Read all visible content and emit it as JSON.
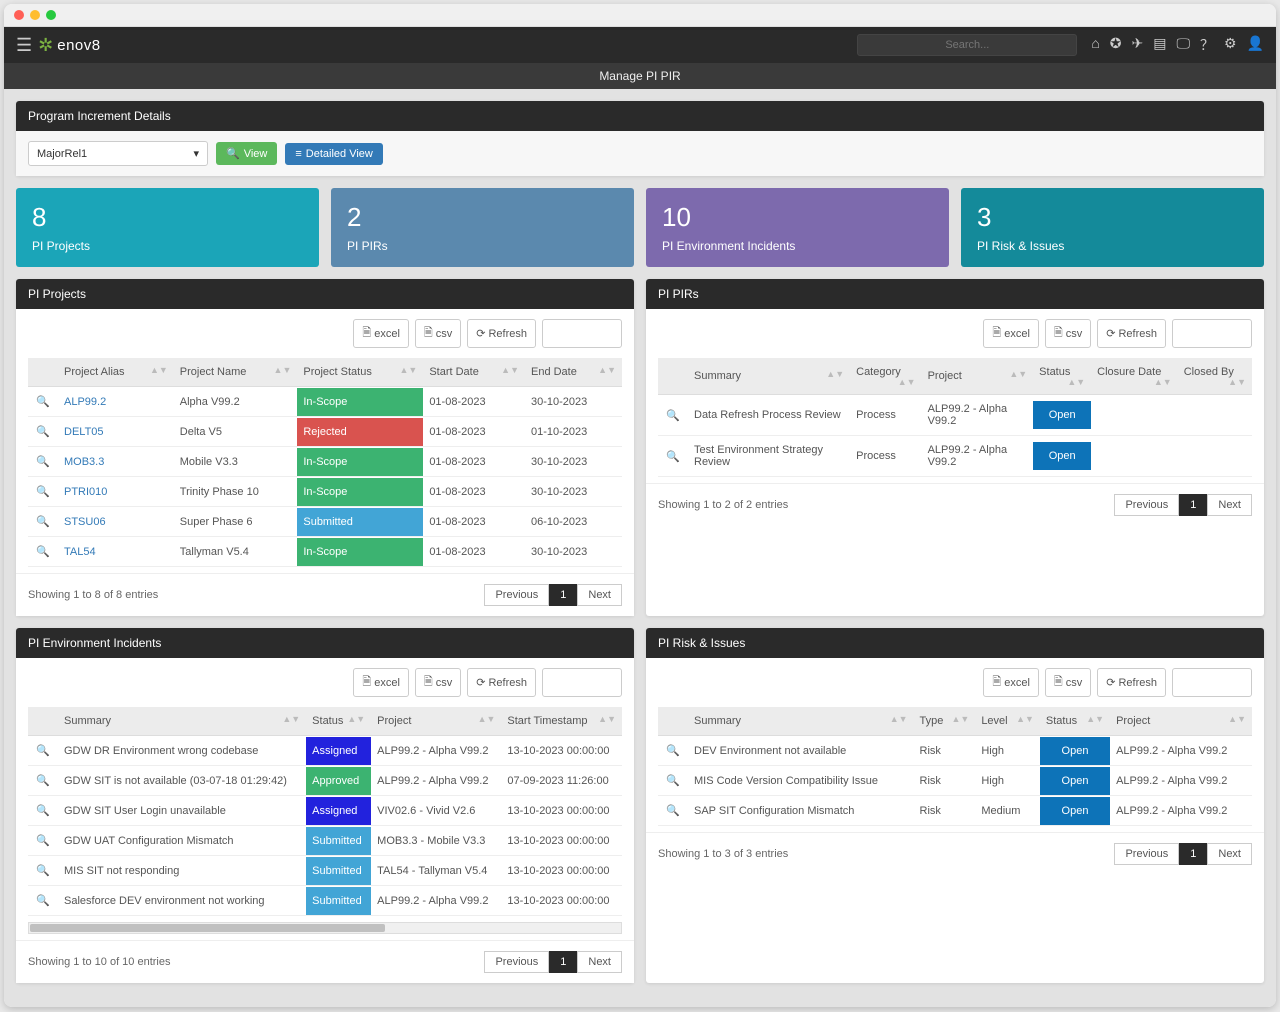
{
  "header": {
    "brand": "enov8",
    "search_placeholder": "Search...",
    "page_title": "Manage PI PIR"
  },
  "details": {
    "panel_title": "Program Increment Details",
    "release_selected": "MajorRel1",
    "view_btn": "View",
    "detailed_btn": "Detailed View"
  },
  "stats": [
    {
      "value": "8",
      "label": "PI Projects"
    },
    {
      "value": "2",
      "label": "PI PIRs"
    },
    {
      "value": "10",
      "label": "PI Environment Incidents"
    },
    {
      "value": "3",
      "label": "PI Risk & Issues"
    }
  ],
  "buttons": {
    "excel": "excel",
    "csv": "csv",
    "refresh": "Refresh",
    "previous": "Previous",
    "next": "Next",
    "page1": "1"
  },
  "projects": {
    "title": "PI Projects",
    "cols": [
      "Project Alias",
      "Project Name",
      "Project Status",
      "Start Date",
      "End Date"
    ],
    "rows": [
      {
        "alias": "ALP99.2",
        "name": "Alpha V99.2",
        "status": "In-Scope",
        "sclass": "s-inscope",
        "start": "01-08-2023",
        "end": "30-10-2023"
      },
      {
        "alias": "DELT05",
        "name": "Delta V5",
        "status": "Rejected",
        "sclass": "s-rejected",
        "start": "01-08-2023",
        "end": "01-10-2023"
      },
      {
        "alias": "MOB3.3",
        "name": "Mobile V3.3",
        "status": "In-Scope",
        "sclass": "s-inscope",
        "start": "01-08-2023",
        "end": "30-10-2023"
      },
      {
        "alias": "PTRI010",
        "name": "Trinity Phase 10",
        "status": "In-Scope",
        "sclass": "s-inscope",
        "start": "01-08-2023",
        "end": "30-10-2023"
      },
      {
        "alias": "STSU06",
        "name": "Super Phase 6",
        "status": "Submitted",
        "sclass": "s-submitted",
        "start": "01-08-2023",
        "end": "06-10-2023"
      },
      {
        "alias": "TAL54",
        "name": "Tallyman V5.4",
        "status": "In-Scope",
        "sclass": "s-inscope",
        "start": "01-08-2023",
        "end": "30-10-2023"
      }
    ],
    "info": "Showing 1 to 8 of 8 entries"
  },
  "pirs": {
    "title": "PI PIRs",
    "cols": [
      "Summary",
      "Category",
      "Project",
      "Status",
      "Closure Date",
      "Closed By"
    ],
    "rows": [
      {
        "summary": "Data Refresh Process Review",
        "category": "Process",
        "project": "ALP99.2 - Alpha V99.2",
        "status": "Open"
      },
      {
        "summary": "Test Environment Strategy Review",
        "category": "Process",
        "project": "ALP99.2 - Alpha V99.2",
        "status": "Open"
      }
    ],
    "info": "Showing 1 to 2 of 2 entries"
  },
  "incidents": {
    "title": "PI Environment Incidents",
    "cols": [
      "Summary",
      "Status",
      "Project",
      "Start Timestamp"
    ],
    "rows": [
      {
        "summary": "GDW DR Environment wrong codebase",
        "status": "Assigned",
        "sclass": "s-assigned",
        "project": "ALP99.2 - Alpha V99.2",
        "ts": "13-10-2023 00:00:00"
      },
      {
        "summary": "GDW SIT is not available (03-07-18 01:29:42)",
        "status": "Approved",
        "sclass": "s-approved",
        "project": "ALP99.2 - Alpha V99.2",
        "ts": "07-09-2023 11:26:00"
      },
      {
        "summary": "GDW SIT User Login unavailable",
        "status": "Assigned",
        "sclass": "s-assigned",
        "project": "VIV02.6 - Vivid V2.6",
        "ts": "13-10-2023 00:00:00"
      },
      {
        "summary": "GDW UAT Configuration Mismatch",
        "status": "Submitted",
        "sclass": "s-submitted",
        "project": "MOB3.3 - Mobile V3.3",
        "ts": "13-10-2023 00:00:00"
      },
      {
        "summary": "MIS SIT not responding",
        "status": "Submitted",
        "sclass": "s-submitted",
        "project": "TAL54 - Tallyman V5.4",
        "ts": "13-10-2023 00:00:00"
      },
      {
        "summary": "Salesforce DEV environment not working",
        "status": "Submitted",
        "sclass": "s-submitted",
        "project": "ALP99.2 - Alpha V99.2",
        "ts": "13-10-2023 00:00:00"
      }
    ],
    "info": "Showing 1 to 10 of 10 entries"
  },
  "risks": {
    "title": "PI Risk & Issues",
    "cols": [
      "Summary",
      "Type",
      "Level",
      "Status",
      "Project"
    ],
    "rows": [
      {
        "summary": "DEV Environment not available",
        "type": "Risk",
        "level": "High",
        "status": "Open",
        "project": "ALP99.2 - Alpha V99.2"
      },
      {
        "summary": "MIS Code Version Compatibility Issue",
        "type": "Risk",
        "level": "High",
        "status": "Open",
        "project": "ALP99.2 - Alpha V99.2"
      },
      {
        "summary": "SAP SIT Configuration Mismatch",
        "type": "Risk",
        "level": "Medium",
        "status": "Open",
        "project": "ALP99.2 - Alpha V99.2"
      }
    ],
    "info": "Showing 1 to 3 of 3 entries"
  }
}
